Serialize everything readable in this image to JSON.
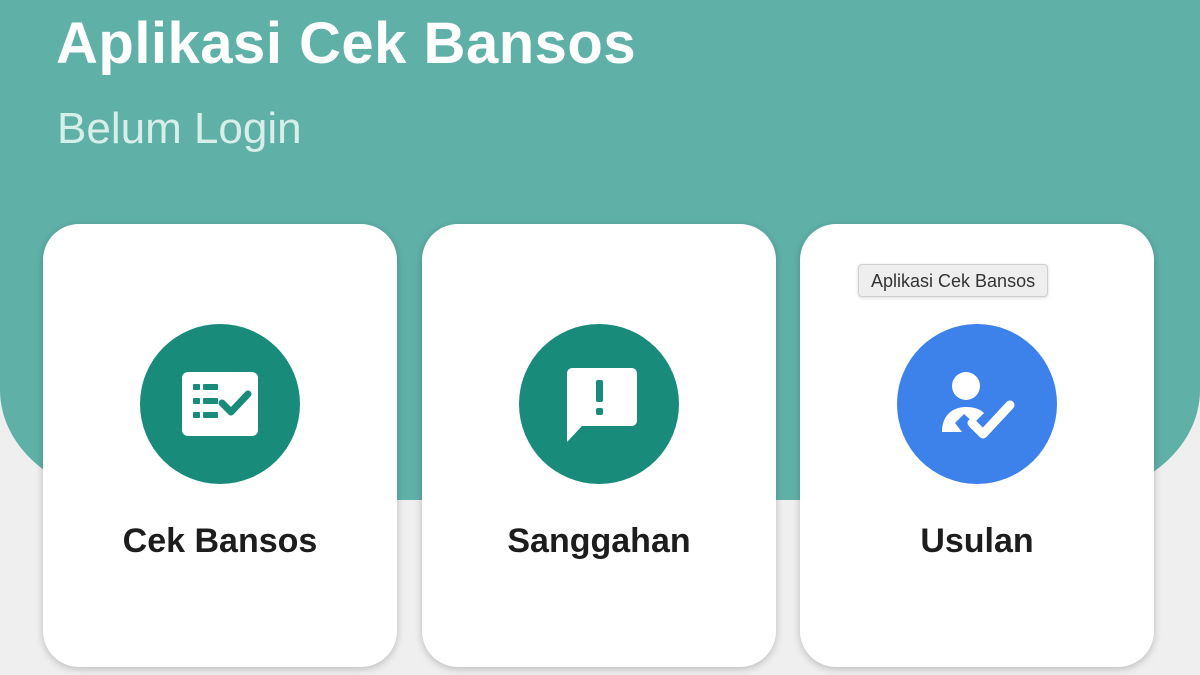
{
  "app": {
    "title": "Aplikasi Cek Bansos",
    "status": "Belum Login"
  },
  "colors": {
    "header": "#5fb1a8",
    "primary_icon_bg": "#188b7b",
    "secondary_icon_bg": "#3d82ea",
    "card_bg": "#ffffff",
    "label_text": "#1d1d1d"
  },
  "menu": {
    "items": [
      {
        "label": "Cek Bansos",
        "icon": "checklist-icon",
        "icon_bg": "#188b7b"
      },
      {
        "label": "Sanggahan",
        "icon": "feedback-icon",
        "icon_bg": "#188b7b"
      },
      {
        "label": "Usulan",
        "icon": "person-check-icon",
        "icon_bg": "#3d82ea"
      }
    ]
  },
  "tooltip": {
    "text": "Aplikasi Cek Bansos"
  }
}
